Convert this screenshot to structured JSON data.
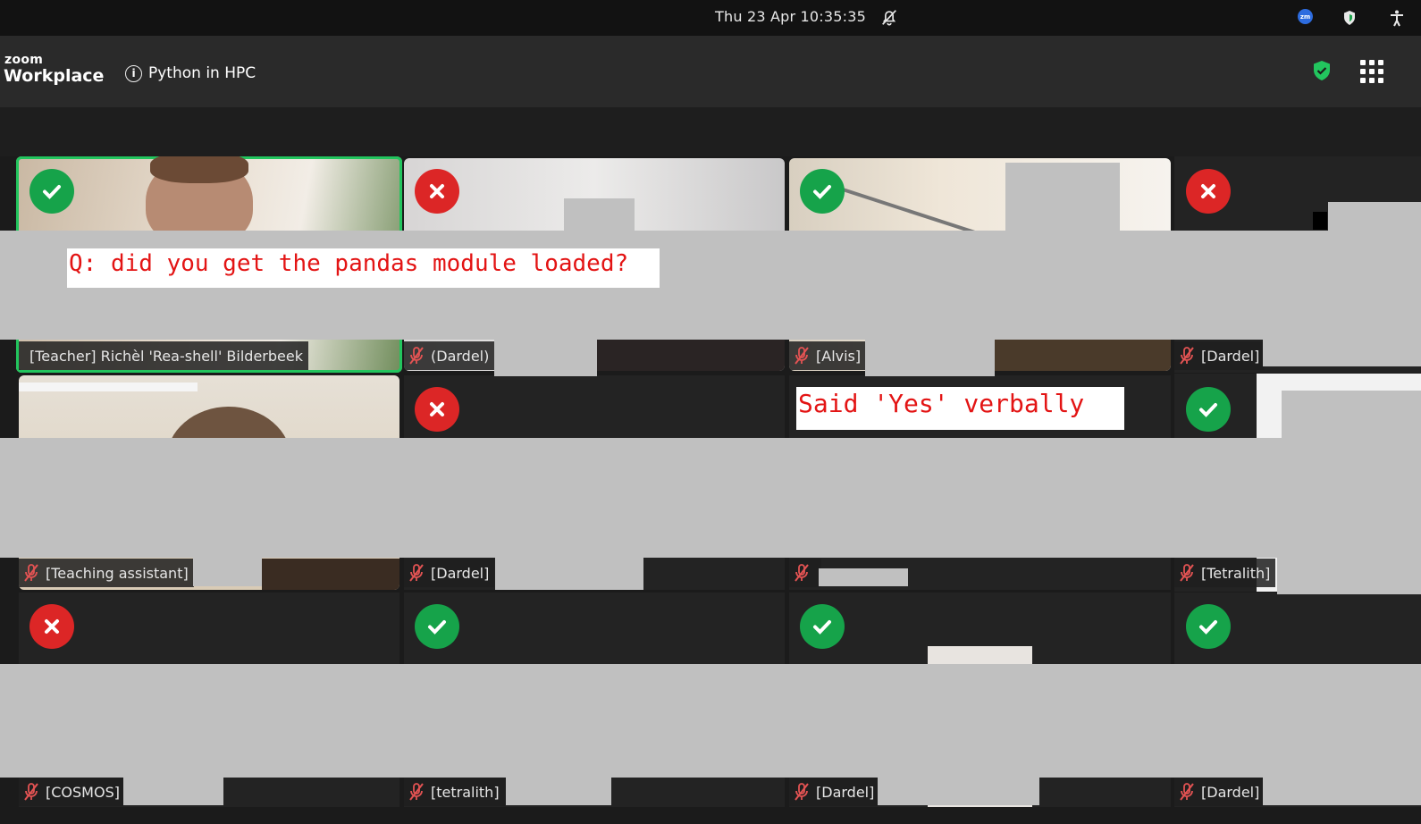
{
  "os_bar": {
    "clock": "Thu 23 Apr  10:35:35",
    "tray_zoom_label": "zm"
  },
  "header": {
    "brand_small": "zoom",
    "brand_big": "Workplace",
    "meeting_title": "Python in HPC",
    "info_icon_glyph": "i"
  },
  "colors": {
    "active_speaker_outline": "#22c55e",
    "yes_status": "#16a34a",
    "no_status": "#dc2626",
    "annotation_text": "#e31414"
  },
  "annotations": {
    "question": "Q: did you get the pandas module loaded?",
    "note": "Said 'Yes' verbally"
  },
  "participants": [
    {
      "name": "[Teacher] Richèl 'Rea-shell' Bilderbeek",
      "status": "yes",
      "muted": false
    },
    {
      "name": "(Dardel)",
      "status": "no",
      "muted": true
    },
    {
      "name": "[Alvis]",
      "status": "yes",
      "muted": true
    },
    {
      "name": "[Dardel]",
      "status": "no",
      "muted": true
    },
    {
      "name": "[Teaching assistant]",
      "status": "none",
      "muted": true
    },
    {
      "name": "[Dardel]",
      "status": "no",
      "muted": true
    },
    {
      "name": "",
      "status": "none",
      "muted": true
    },
    {
      "name": "[Tetralith]",
      "status": "yes",
      "muted": true
    },
    {
      "name": "[COSMOS]",
      "status": "no",
      "muted": true
    },
    {
      "name": "[tetralith]",
      "status": "yes",
      "muted": true
    },
    {
      "name": "[Dardel]",
      "status": "yes",
      "muted": true
    },
    {
      "name": "[Dardel]",
      "status": "yes",
      "muted": true
    }
  ]
}
